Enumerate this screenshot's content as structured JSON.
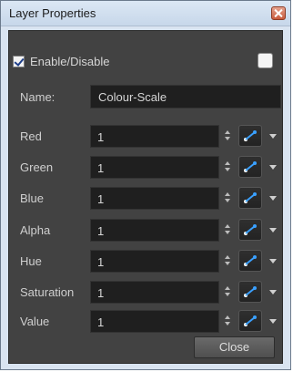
{
  "window": {
    "title": "Layer Properties"
  },
  "enable": {
    "label": "Enable/Disable",
    "checked": true
  },
  "name": {
    "label": "Name:",
    "value": "Colour-Scale"
  },
  "properties": [
    {
      "label": "Red",
      "value": "1"
    },
    {
      "label": "Green",
      "value": "1"
    },
    {
      "label": "Blue",
      "value": "1"
    },
    {
      "label": "Alpha",
      "value": "1"
    },
    {
      "label": "Hue",
      "value": "1"
    },
    {
      "label": "Saturation",
      "value": "1"
    },
    {
      "label": "Value",
      "value": "1"
    }
  ],
  "footer": {
    "close_label": "Close"
  },
  "icons": {
    "function_button": "function-curve-icon",
    "dropdown": "chevron-down-icon",
    "spinner": "spinner-icon"
  },
  "colors": {
    "panel_bg": "#424242",
    "field_bg": "#1f1f1f",
    "accent_blue": "#3aa0ff",
    "title_bar": "#c7d7ea"
  }
}
